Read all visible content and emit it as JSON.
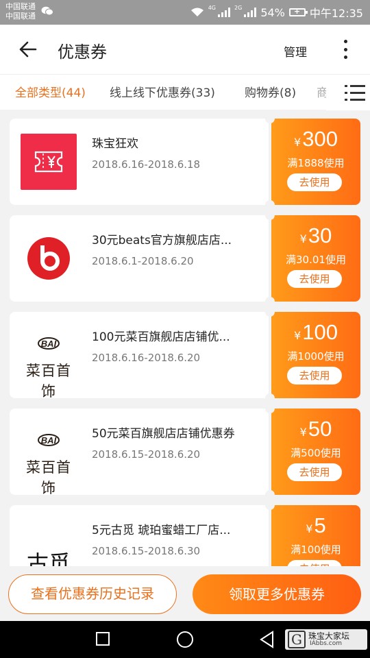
{
  "status_bar": {
    "carrier_1": "中国联通",
    "carrier_2": "中国联通",
    "net_1": "4G",
    "net_2": "2G",
    "battery": "54%",
    "time": "中午12:35"
  },
  "header": {
    "title": "优惠券",
    "manage_label": "管理"
  },
  "tabs": [
    {
      "label": "全部类型(44)",
      "active": true
    },
    {
      "label": "线上线下优惠券(33)",
      "active": false
    },
    {
      "label": "购物券(8)",
      "active": false
    },
    {
      "label": "商",
      "active": false
    }
  ],
  "coupons": [
    {
      "title": "珠宝狂欢",
      "date": "2018.6.16-2018.6.18",
      "currency": "¥",
      "amount": "300",
      "condition": "满1888使用",
      "button": "去使用",
      "logo": "ticket-yen-icon"
    },
    {
      "title": "30元beats官方旗舰店店...",
      "date": "2018.6.1-2018.6.20",
      "currency": "¥",
      "amount": "30",
      "condition": "满30.01使用",
      "button": "去使用",
      "logo": "beats-logo"
    },
    {
      "title": "100元菜百旗舰店店铺优...",
      "date": "2018.6.16-2018.6.20",
      "currency": "¥",
      "amount": "100",
      "condition": "满1000使用",
      "button": "去使用",
      "logo": "caibai-logo",
      "logo_mark": "BAI",
      "logo_text": "菜百首饰"
    },
    {
      "title": "50元菜百旗舰店店铺优惠券",
      "date": "2018.6.15-2018.6.20",
      "currency": "¥",
      "amount": "50",
      "condition": "满500使用",
      "button": "去使用",
      "logo": "caibai-logo",
      "logo_mark": "BAI",
      "logo_text": "菜百首饰"
    },
    {
      "title": "5元古觅 琥珀蜜蜡工厂店...",
      "date": "2018.6.15-2018.6.30",
      "currency": "¥",
      "amount": "5",
      "condition": "满100使用",
      "button": "去使用",
      "logo": "gumi-logo",
      "logo_text": "古觅"
    }
  ],
  "bottom": {
    "history_label": "查看优惠券历史记录",
    "more_label": "领取更多优惠券"
  },
  "watermark": {
    "name": "珠宝大家坛",
    "url": "IAbbs.com"
  },
  "colors": {
    "accent": "#e8711e",
    "coupon_gradient_start": "#ff9b1a",
    "coupon_gradient_end": "#ff6c14",
    "red_logo": "#f02d49",
    "beats_red": "#e02027"
  }
}
